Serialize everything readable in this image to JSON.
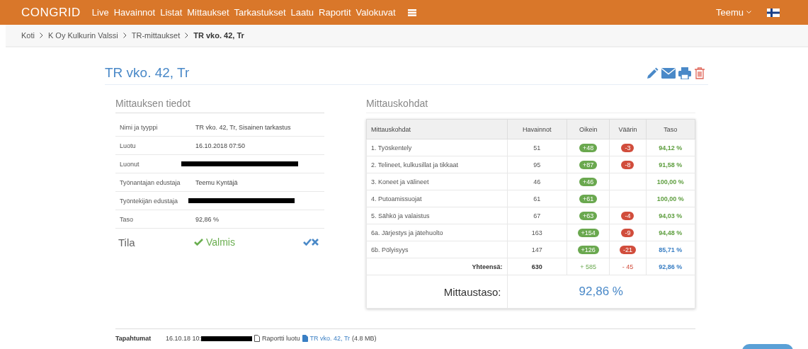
{
  "navbar": {
    "logo": "CONGRID",
    "items": [
      {
        "label": "Live",
        "selected": false
      },
      {
        "label": "Havainnot",
        "selected": false
      },
      {
        "label": "Listat",
        "selected": false
      },
      {
        "label": "Mittaukset",
        "selected": false
      },
      {
        "label": "Tarkastukset",
        "selected": false
      },
      {
        "label": "Laatu",
        "selected": false
      },
      {
        "label": "Raportit",
        "selected": false
      },
      {
        "label": "Valokuvat",
        "selected": false
      }
    ],
    "user": "Teemu"
  },
  "breadcrumb": [
    "Koti",
    "K Oy Kulkurin Valssi",
    "TR-mittaukset",
    "TR vko. 42, Tr"
  ],
  "title": "TR vko. 42, Tr",
  "details": {
    "heading": "Mittauksen tiedot",
    "rows": [
      {
        "label": "Nimi ja tyyppi",
        "value": "TR vko. 42, Tr, Sisainen tarkastus",
        "kind": "text"
      },
      {
        "label": "Luotu",
        "value": "16.10.2018 07:50",
        "kind": "text"
      },
      {
        "label": "Luonut",
        "kind": "redacted"
      },
      {
        "label": "Työnantajan edustaja",
        "value": "Teemu Kyntäjä",
        "kind": "text"
      },
      {
        "label": "Työntekijän edustaja",
        "kind": "redacted"
      },
      {
        "label": "Taso",
        "value": "92,86 %",
        "kind": "text"
      }
    ],
    "status": {
      "label": "Tila",
      "value": "Valmis"
    }
  },
  "measurements": {
    "heading": "Mittauskohdat",
    "columns": [
      "Mittauskohdat",
      "Havainnot",
      "Oikein",
      "Väärin",
      "Taso"
    ],
    "rows": [
      {
        "name": "1. Työskentely",
        "count": "51",
        "correct": "+48",
        "wrong": "-3",
        "level": "94,12 %",
        "color": "#5e9e3f"
      },
      {
        "name": "2. Telineet, kulkusillat ja tikkaat",
        "count": "95",
        "correct": "+87",
        "wrong": "-8",
        "level": "91,58 %",
        "color": "#5e9e3f"
      },
      {
        "name": "3. Koneet ja välineet",
        "count": "46",
        "correct": "+46",
        "level": "100,00 %",
        "color": "#5e9e3f"
      },
      {
        "name": "4. Putoamissuojat",
        "count": "61",
        "correct": "+61",
        "level": "100,00 %",
        "color": "#5e9e3f"
      },
      {
        "name": "5. Sähkö ja valaistus",
        "count": "67",
        "correct": "+63",
        "wrong": "-4",
        "level": "94,03 %",
        "color": "#5e9e3f"
      },
      {
        "name": "6a. Järjestys ja jätehuolto",
        "count": "163",
        "correct": "+154",
        "wrong": "-9",
        "level": "94,48 %",
        "color": "#5e9e3f"
      },
      {
        "name": "6b. Pölyisyys",
        "count": "147",
        "correct": "+126",
        "wrong": "-21",
        "level": "85,71 %",
        "color": "#3a7fc4"
      }
    ],
    "total": {
      "label": "Yhteensä:",
      "count": "630",
      "correct": "+ 585",
      "wrong": "- 45",
      "level": "92,86 %"
    },
    "score": {
      "label": "Mittaustaso:",
      "value": "92,86 %"
    }
  },
  "events": {
    "label": "Tapahtumat",
    "time": "16.10.18 10:",
    "action": "Raportti luotu",
    "file": "TR vko. 42, Tr",
    "size": "(4.8 MB)"
  }
}
